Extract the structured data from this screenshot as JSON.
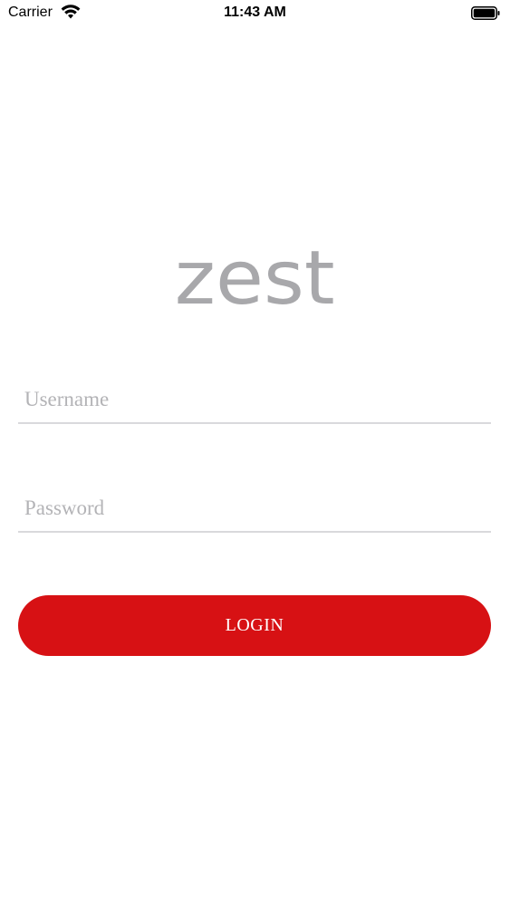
{
  "status_bar": {
    "carrier": "Carrier",
    "time": "11:43 AM",
    "wifi_icon": "wifi-icon",
    "battery_icon": "battery-icon"
  },
  "logo": {
    "text": "zest",
    "color": "#a8a8ab"
  },
  "form": {
    "username": {
      "placeholder": "Username",
      "value": ""
    },
    "password": {
      "placeholder": "Password",
      "value": ""
    },
    "login_label": "LOGIN"
  },
  "colors": {
    "accent": "#d71114",
    "divider": "#d9d9dc",
    "placeholder": "#b3b3b6"
  }
}
